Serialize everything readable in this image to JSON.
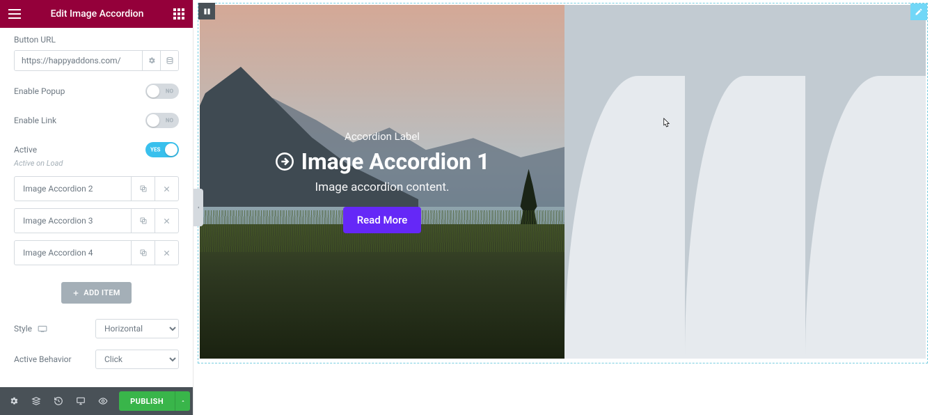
{
  "header": {
    "title": "Edit Image Accordion"
  },
  "panel": {
    "button_url": {
      "label": "Button URL",
      "value": "https://happyaddons.com/"
    },
    "enable_popup": {
      "label": "Enable Popup",
      "on": false,
      "off_text": "NO"
    },
    "enable_link": {
      "label": "Enable Link",
      "on": false,
      "off_text": "NO"
    },
    "active": {
      "label": "Active",
      "on": true,
      "on_text": "YES",
      "sub": "Active on Load"
    },
    "repeater": [
      {
        "title": "Image Accordion 2"
      },
      {
        "title": "Image Accordion 3"
      },
      {
        "title": "Image Accordion 4"
      }
    ],
    "add_item": "ADD ITEM",
    "style": {
      "label": "Style",
      "value": "Horizontal"
    },
    "active_behavior": {
      "label": "Active Behavior",
      "value": "Click"
    }
  },
  "footer": {
    "publish": "PUBLISH"
  },
  "preview": {
    "accordion": {
      "label": "Accordion Label",
      "title": "Image Accordion 1",
      "content": "Image accordion content.",
      "button": "Read More"
    }
  }
}
